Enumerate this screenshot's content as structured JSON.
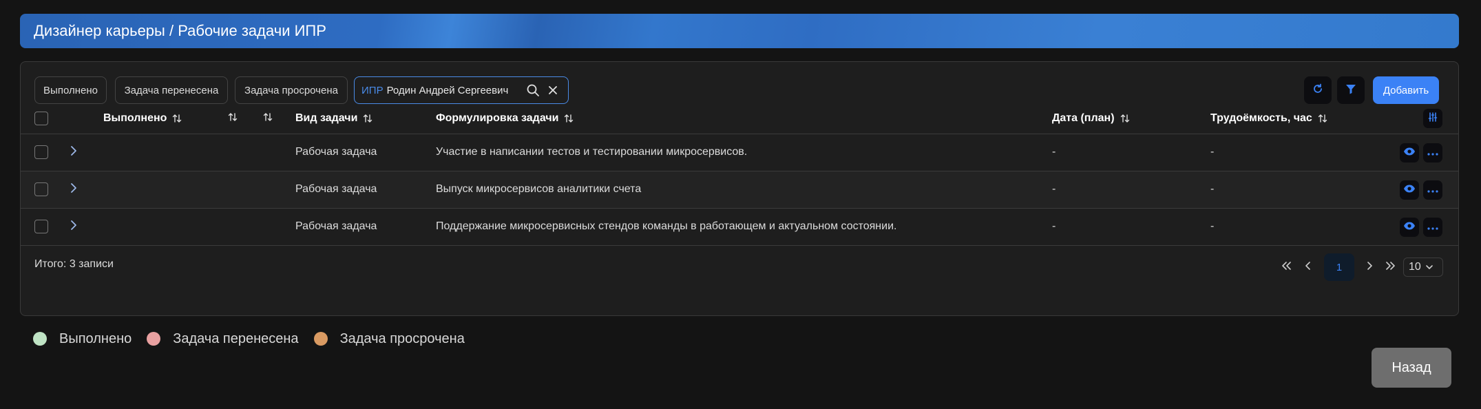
{
  "header": {
    "title": "Дизайнер карьеры / Рабочие задачи ИПР"
  },
  "toolbar": {
    "chips": [
      "Выполнено",
      "Задача перенесена",
      "Задача просрочена"
    ],
    "filter": {
      "key": "ИПР",
      "value": "Родин Андрей Сергеевич"
    },
    "add_label": "Добавить"
  },
  "table": {
    "columns": {
      "done": "Выполнено",
      "type": "Вид задачи",
      "wording": "Формулировка задачи",
      "date": "Дата (план)",
      "effort": "Трудоёмкость, час"
    },
    "rows": [
      {
        "type": "Рабочая задача",
        "wording": "Участие в написании тестов и тестировании микросервисов.",
        "date": "-",
        "effort": "-"
      },
      {
        "type": "Рабочая задача",
        "wording": "Выпуск микросервисов аналитики счета",
        "date": "-",
        "effort": "-"
      },
      {
        "type": "Рабочая задача",
        "wording": "Поддержание микросервисных стендов команды в работающем и актуальном состоянии.",
        "date": "-",
        "effort": "-"
      }
    ]
  },
  "footer": {
    "total": "Итого: 3 записи",
    "current_page": "1",
    "page_size": "10"
  },
  "legend": [
    {
      "label": "Выполнено",
      "color": "#bfe3c4"
    },
    {
      "label": "Задача перенесена",
      "color": "#e8a0a0"
    },
    {
      "label": "Задача просрочена",
      "color": "#d99a62"
    }
  ],
  "back_label": "Назад",
  "colors": {
    "accent": "#3b82f6",
    "panel": "#1e1e1e",
    "background": "#141414"
  },
  "icons": {
    "search": "search-icon",
    "clear": "close-icon",
    "refresh": "refresh-icon",
    "filter": "filter-icon",
    "columns": "columns-settings-icon",
    "view": "eye-icon",
    "more": "more-icon",
    "expand": "chevron-right-icon",
    "sort": "sort-icon"
  }
}
